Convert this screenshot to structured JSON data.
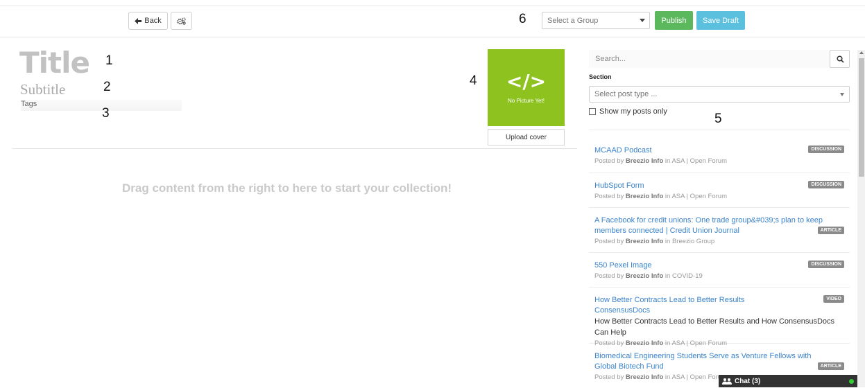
{
  "toolbar": {
    "back_label": "Back",
    "group_placeholder": "Select a Group",
    "publish_label": "Publish",
    "save_draft_label": "Save Draft"
  },
  "markers": {
    "m1": "1",
    "m2": "2",
    "m3": "3",
    "m4": "4",
    "m5": "5",
    "m6": "6"
  },
  "editor": {
    "title": "Title",
    "subtitle": "Subtitle",
    "tags": "Tags",
    "dropzone_text": "Drag content from the right to here to start your collection!"
  },
  "cover": {
    "code_glyph": "</>",
    "no_picture": "No Picture Yet!",
    "upload_label": "Upload cover"
  },
  "sidebar": {
    "search_placeholder": "Search...",
    "section_label": "Section",
    "post_type_placeholder": "Select post type ...",
    "show_my_posts": "Show my posts only",
    "posts": [
      {
        "title": "MCAAD Podcast",
        "badge": "DISCUSSION",
        "description": "",
        "author": "Breezio Info",
        "group": "ASA | Open Forum"
      },
      {
        "title": "HubSpot Form",
        "badge": "DISCUSSION",
        "description": "",
        "author": "Breezio Info",
        "group": "ASA | Open Forum"
      },
      {
        "title": "A Facebook for credit unions: One trade group&#039;s plan to keep members connected | Credit Union Journal",
        "badge": "ARTICLE",
        "description": "",
        "author": "Breezio Info",
        "group": "Breezio Group"
      },
      {
        "title": "550 Pexel Image",
        "badge": "DISCUSSION",
        "description": "",
        "author": "Breezio Info",
        "group": "COVID-19"
      },
      {
        "title": "How Better Contracts Lead to Better Results ConsensusDocs",
        "badge": "VIDEO",
        "description": "How Better Contracts Lead to Better Results and How ConsensusDocs Can Help",
        "author": "Breezio Info",
        "group": "ASA | Open Forum"
      },
      {
        "title": "Biomedical Engineering Students Serve as Venture Fellows with Global Biotech Fund",
        "badge": "ARTICLE",
        "description": "",
        "author": "Breezio Info",
        "group": "ASA | Open Forum"
      }
    ],
    "posted_by": "Posted by",
    "in_word": "in"
  },
  "chat": {
    "label": "Chat (3)"
  },
  "colors": {
    "publish": "#5cb85c",
    "save_draft": "#5bc0de",
    "cover": "#8dc21f",
    "link": "#3a83cc"
  }
}
